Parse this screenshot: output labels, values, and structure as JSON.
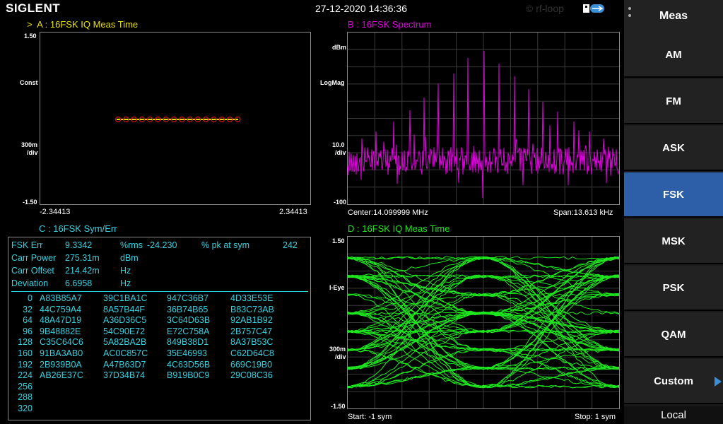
{
  "header": {
    "brand": "SIGLENT",
    "datetime": "27-12-2020 14:36:36",
    "watermark": "© rf-loop"
  },
  "panelA": {
    "marker": ">",
    "title": "A :  16FSK  IQ Meas Time",
    "y_top": "1.50",
    "y_mid": "Const",
    "y_scale": "300m",
    "y_div": "/div",
    "y_bottom": "-1.50",
    "x_left": "-2.34413",
    "x_right": "2.34413"
  },
  "panelB": {
    "title": "B :  16FSK  Spectrum",
    "unit": "dBm",
    "mode": "LogMag",
    "scale": "10.0",
    "div": "/div",
    "bottom": "-100",
    "center": "Center:14.099999 MHz",
    "span": "Span:13.613 kHz"
  },
  "panelC": {
    "title": "C :  16FSK  Sym/Err",
    "metrics": [
      {
        "name": "FSK Err",
        "value": "9.3342",
        "unit": "%rms",
        "extra_value": "-24.230",
        "extra_unit": "%  pk at sym",
        "extra_num": "242"
      },
      {
        "name": "Carr Power",
        "value": "275.31m",
        "unit": "dBm",
        "extra_value": "",
        "extra_unit": "",
        "extra_num": ""
      },
      {
        "name": "Carr Offset",
        "value": "214.42m",
        "unit": "Hz",
        "extra_value": "",
        "extra_unit": "",
        "extra_num": ""
      },
      {
        "name": "Deviation",
        "value": "6.6958",
        "unit": "Hz",
        "extra_value": "",
        "extra_unit": "",
        "extra_num": ""
      }
    ],
    "symbols": [
      {
        "idx": "0",
        "c1": "A83B85A7",
        "c2": "39C1BA1C",
        "c3": "947C36B7",
        "c4": "4D33E53E"
      },
      {
        "idx": "32",
        "c1": "44C759A4",
        "c2": "8A57B44F",
        "c3": "36B74B65",
        "c4": "B83C73AB"
      },
      {
        "idx": "64",
        "c1": "48A47D19",
        "c2": "A36D36C5",
        "c3": "3C64D63B",
        "c4": "92AB1B92"
      },
      {
        "idx": "96",
        "c1": "9B48882E",
        "c2": "54C90E72",
        "c3": "E72C758A",
        "c4": "2B757C47"
      },
      {
        "idx": "128",
        "c1": "C35C64C6",
        "c2": "5A82BA2B",
        "c3": "849B38D1",
        "c4": "8A37B53C"
      },
      {
        "idx": "160",
        "c1": "91BA3AB0",
        "c2": "AC0C857C",
        "c3": "35E46993",
        "c4": "C62D64C8"
      },
      {
        "idx": "192",
        "c1": "2B939B0A",
        "c2": "A47B63D7",
        "c3": "4C63D56B",
        "c4": "669C19B0"
      },
      {
        "idx": "224",
        "c1": "AB26E37C",
        "c2": "37D34B74",
        "c3": "B919B0C9",
        "c4": "29C08C36"
      },
      {
        "idx": "256",
        "c1": "",
        "c2": "",
        "c3": "",
        "c4": ""
      },
      {
        "idx": "288",
        "c1": "",
        "c2": "",
        "c3": "",
        "c4": ""
      },
      {
        "idx": "320",
        "c1": "",
        "c2": "",
        "c3": "",
        "c4": ""
      }
    ]
  },
  "panelD": {
    "title": "D :  16FSK  IQ Meas Time",
    "y_top": "1.50",
    "y_mid": "I-Eye",
    "y_scale": "300m",
    "y_div": "/div",
    "y_bottom": "-1.50",
    "start": "Start: -1 sym",
    "stop": "Stop: 1 sym"
  },
  "sidebar": {
    "title": "Meas",
    "items": [
      {
        "label": "AM"
      },
      {
        "label": "FM"
      },
      {
        "label": "ASK"
      },
      {
        "label": "FSK"
      },
      {
        "label": "MSK"
      },
      {
        "label": "PSK"
      },
      {
        "label": "QAM"
      },
      {
        "label": "Custom"
      }
    ],
    "footer": "Local"
  },
  "colors": {
    "traceA": "#e8e000",
    "traceB": "#e000e0",
    "traceC": "#33d2e0",
    "traceD": "#1ee81e",
    "active": "#2c5fa8"
  }
}
